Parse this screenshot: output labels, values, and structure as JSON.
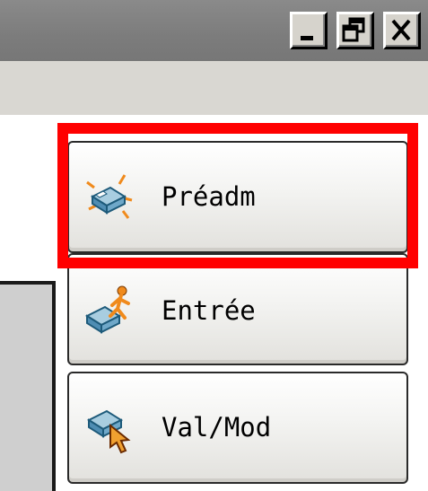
{
  "window": {
    "controls": [
      {
        "name": "minimize-button",
        "icon": "minimize-icon"
      },
      {
        "name": "restore-button",
        "icon": "restore-icon"
      },
      {
        "name": "close-button",
        "icon": "close-icon"
      }
    ]
  },
  "actions": [
    {
      "id": "preadm",
      "label": "Préadm",
      "icon": "bed-sparkle-icon"
    },
    {
      "id": "entree",
      "label": "Entrée",
      "icon": "bed-walking-person-icon"
    },
    {
      "id": "valmod",
      "label": "Val/Mod",
      "icon": "bed-cursor-icon"
    }
  ],
  "highlight": {
    "target": "preadm",
    "color": "#ff0000"
  },
  "colors": {
    "titlebar": "#808080",
    "menubar": "#d9d7d2",
    "button_border": "#2a2a2a"
  }
}
